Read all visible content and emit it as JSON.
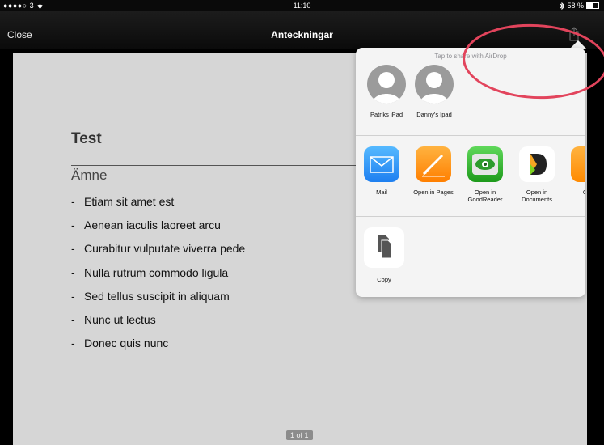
{
  "status_bar": {
    "carrier": "●●●●○ 3",
    "time": "11:10",
    "battery_text": "58 %",
    "battery_level": 0.58
  },
  "nav_bar": {
    "close_label": "Close",
    "title": "Anteckningar",
    "share_icon": "share-icon"
  },
  "document": {
    "title": "Test",
    "subject": "Ämne",
    "bullet": "-",
    "items": [
      "Etiam sit amet est",
      "Aenean iaculis laoreet arcu",
      "Curabitur vulputate viverra pede",
      "Nulla rutrum commodo ligula",
      "Sed tellus suscipit in aliquam",
      "Nunc ut lectus",
      "Donec quis nunc"
    ],
    "page_indicator": "1 of 1"
  },
  "share_sheet": {
    "airdrop_hint": "Tap to share with AirDrop",
    "devices": [
      {
        "label": "Patriks iPad",
        "icon": "person-icon"
      },
      {
        "label": "Danny's Ipad",
        "icon": "person-icon"
      }
    ],
    "apps": [
      {
        "label": "Mail",
        "icon": "mail-icon"
      },
      {
        "label": "Open in Pages",
        "icon": "pages-icon"
      },
      {
        "label": "Open in GoodReader",
        "icon": "goodreader-icon"
      },
      {
        "label": "Open in Documents",
        "icon": "documents-icon"
      },
      {
        "label": "Ope",
        "icon": "app-icon"
      }
    ],
    "actions": [
      {
        "label": "Copy",
        "icon": "copy-icon"
      }
    ]
  },
  "colors": {
    "annotation": "#e2445c",
    "mail_blue": "#2d8cf0",
    "pages_orange": "#ff9500",
    "goodreader_green": "#33b532"
  }
}
